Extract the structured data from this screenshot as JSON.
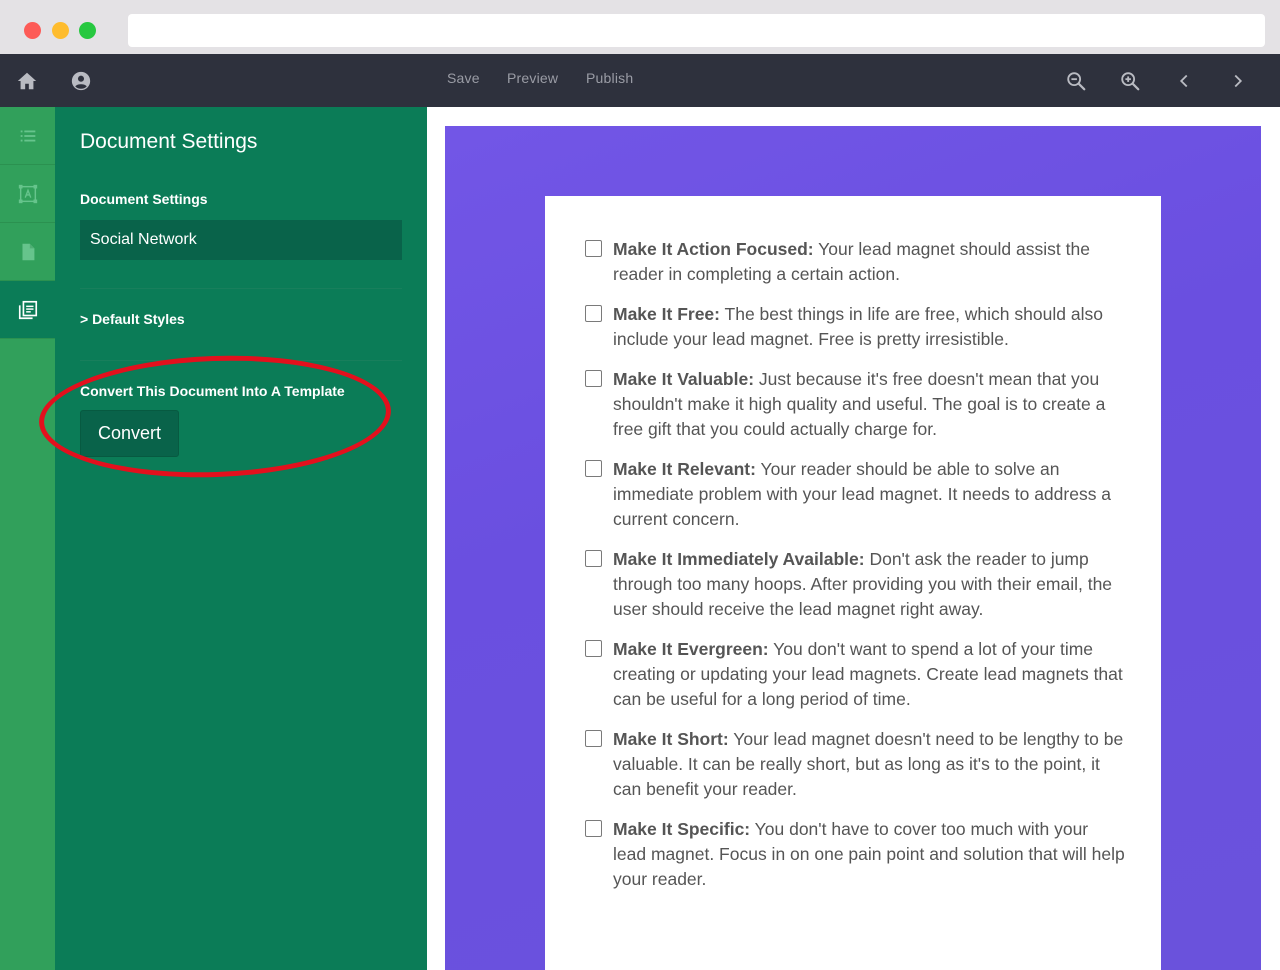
{
  "toolbar": {
    "save_label": "Save",
    "preview_label": "Preview",
    "publish_label": "Publish"
  },
  "panel": {
    "title": "Document Settings",
    "settings_label": "Document Settings",
    "document_name_value": "Social Network",
    "default_styles_label": ">  Default Styles",
    "template_label": "Convert This Document Into A Template",
    "convert_label": "Convert"
  },
  "checklist": [
    {
      "title": "Make It Action Focused:",
      "body": " Your lead magnet should assist the reader in completing a certain action."
    },
    {
      "title": "Make It Free:",
      "body": " The best things in life are free, which should also include your lead magnet. Free is pretty irresistible."
    },
    {
      "title": "Make It Valuable:",
      "body": " Just because it's free doesn't mean that you shouldn't make it high quality and useful. The goal is to create a free gift that you could actually charge for."
    },
    {
      "title": "Make It Relevant:",
      "body": " Your reader should be able to solve an immediate problem with your lead magnet. It needs to address a current concern."
    },
    {
      "title": "Make It Immediately Available:",
      "body": " Don't ask the reader to jump through too many hoops. After providing you with their email, the user should receive the lead magnet right away."
    },
    {
      "title": "Make It Evergreen:",
      "body": " You don't want to spend a lot of your time creating or updating your lead magnets. Create lead magnets that can be useful for a long period of time."
    },
    {
      "title": "Make It Short:",
      "body": " Your lead magnet doesn't need to be lengthy to be valuable. It can be really short, but as long as it's to the point, it can benefit your reader."
    },
    {
      "title": "Make It Specific:",
      "body": " You don't have to cover too much with your lead magnet. Focus in on one pain point and solution that will help your reader."
    }
  ],
  "icons": {
    "home": "home-icon",
    "account": "account-icon",
    "zoom_out": "zoom-out-icon",
    "zoom_in": "zoom-in-icon",
    "prev": "chevron-left-icon",
    "next": "chevron-right-icon"
  },
  "colors": {
    "panel_green": "#0b7c57",
    "rail_green": "#31a05b",
    "canvas_purple": "#6a4fe0",
    "toolbar_dark": "#2e313d",
    "highlight_red": "#e3101d"
  }
}
